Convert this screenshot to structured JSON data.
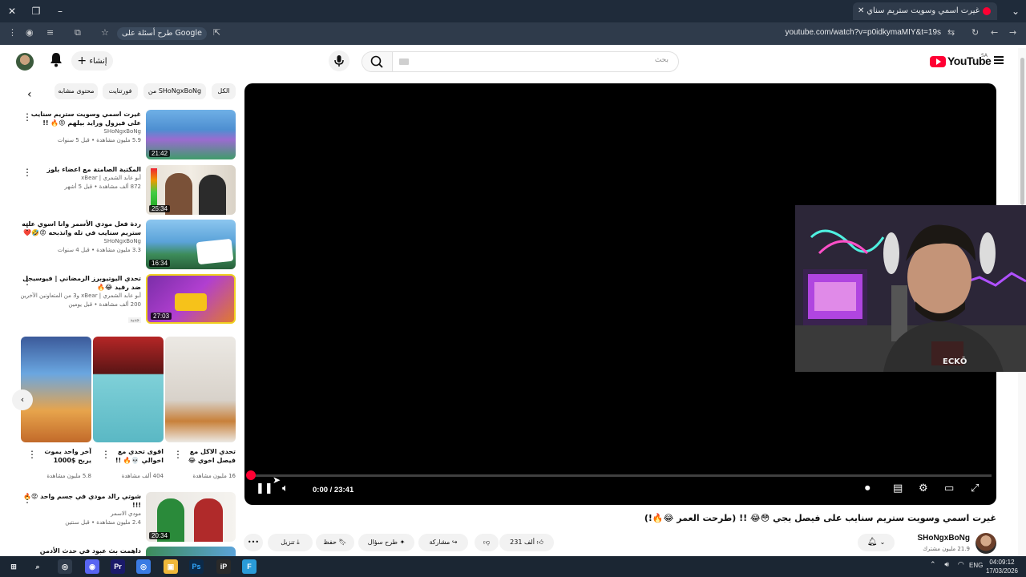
{
  "browser": {
    "tab_title": "غيرت اسمي وسويت ستريم سناي",
    "url": "youtube.com/watch?v=p0idkymaMIY&t=19s",
    "gemini_chip": "طرح أسئلة على Google"
  },
  "header": {
    "create_label": "إنشاء",
    "search_placeholder": "بحث",
    "logo_text": "YouTube",
    "country": "SA"
  },
  "chips": [
    {
      "label": "الكل"
    },
    {
      "label": "من SHoNgxBoNg"
    },
    {
      "label": "فورتنايت"
    },
    {
      "label": "محتوى مشابه"
    }
  ],
  "sidebar_videos": [
    {
      "title": "غيرت اسمي وسويت ستريم سنايب على فيزول ورايد بيلهم 😡🔥 !! (داهموني...",
      "channel": "SHoNgxBoNg",
      "meta": "5.9 مليون مشاهدة • قبل 5 سنوات",
      "duration": "21:42"
    },
    {
      "title": "المكتبة الصامتة مع اعضاء بلوز",
      "channel": "أبو عابد الشمري | xBear",
      "meta": "872 ألف مشاهدة • قبل 5 أشهر",
      "duration": "25:34"
    },
    {
      "title": "ردة فعل مودي الأسمر وانا اسوي عليه ستريم سنايب في تله وانذبحه 😡🤣❤️ !!!",
      "channel": "SHoNgxBoNg",
      "meta": "3.3 مليون مشاهدة • قبل 4 سنوات",
      "duration": "16:34"
    },
    {
      "title": "تحدي اليوتيوبرز الرمضاني | فيوسيجل ضد رفيد 😂🔥",
      "channel": "أبو عابد الشمري | xBear و3 من المتعاونين الآخرين",
      "meta": "200 ألف مشاهدة • قبل يومين",
      "badge": "جديد",
      "duration": "27:03"
    },
    {
      "title": "شوتي رالد مودي في جسم واحد 😡🔥 !!!",
      "channel": "مودي الاسمر",
      "meta": "2.4 مليون مشاهدة • قبل سنتين",
      "duration": "20:34"
    },
    {
      "title": "داهمت بث عبود في حدث الأدمن ومراقبه 🔥",
      "channel": "",
      "meta": "",
      "duration": ""
    }
  ],
  "shorts": [
    {
      "title": "آخر واحد يموت يربح $1000",
      "views": "5.8 مليون مشاهدة"
    },
    {
      "title": "اقوى تحدي مع اخوالي 💀🔥 !!",
      "views": "404 ألف مشاهدة"
    },
    {
      "title": "تحدي الاكل مع فيصل اخوي 😂",
      "views": "16 مليون مشاهدة"
    }
  ],
  "player": {
    "time": "0:00 / 23:41",
    "progress": 0.0,
    "facecam_label": "ECKŌ"
  },
  "video": {
    "title": "غيرت اسمي وسويت ستريم سنايب على فيصل يجي 😳😂 !! (طرحت العمر 😂🔥!)",
    "channel_name": "SHoNgxBoNg",
    "subscribers": "21.9 مليون مشترك",
    "like_count": "231 ألف",
    "share_label": "مشاركة",
    "ask_label": "طرح سؤال",
    "save_label": "حفظ",
    "download_label": "تنزيل"
  },
  "taskbar": {
    "time": "04:09:12",
    "date": "17/03/2026",
    "lang": "ENG"
  },
  "colors": {
    "brand_red": "#ff0033",
    "titlebar": "#1f2b3a",
    "taskbar": "#1b2633"
  }
}
